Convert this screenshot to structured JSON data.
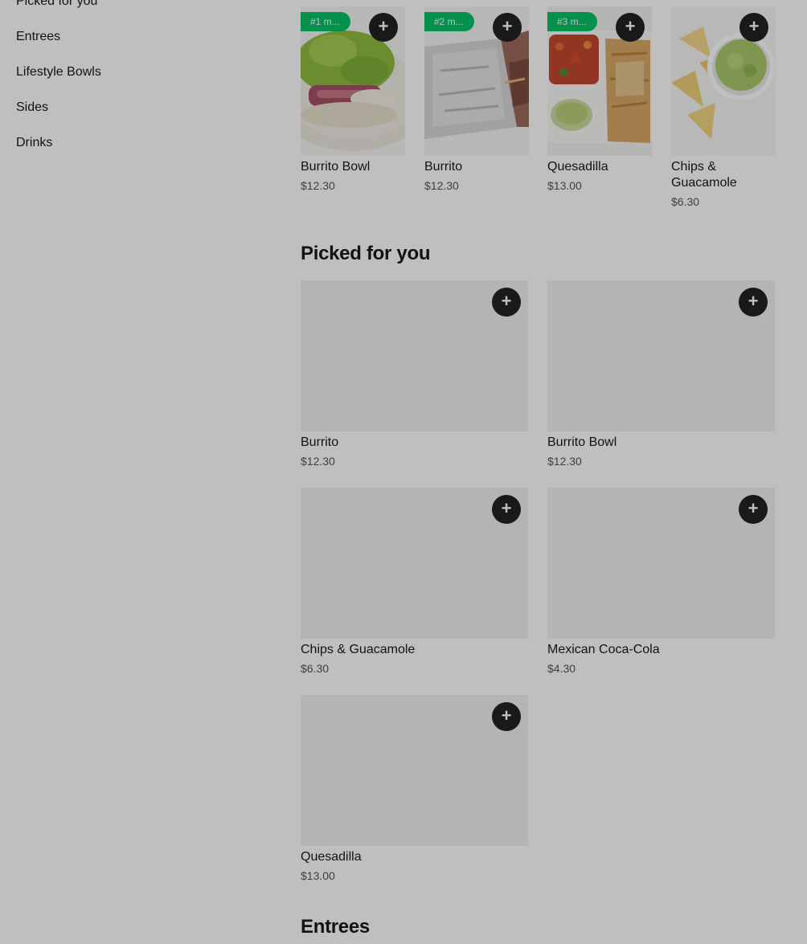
{
  "sidebar": {
    "items": [
      {
        "label": "Picked for you"
      },
      {
        "label": "Entrees"
      },
      {
        "label": "Lifestyle Bowls"
      },
      {
        "label": "Sides"
      },
      {
        "label": "Drinks"
      }
    ]
  },
  "popular": {
    "items": [
      {
        "rank_badge": "#1 m...",
        "name": "Burrito Bowl",
        "price": "$12.30",
        "add_icon": "plus-icon"
      },
      {
        "rank_badge": "#2 m...",
        "name": "Burrito",
        "price": "$12.30",
        "add_icon": "plus-icon"
      },
      {
        "rank_badge": "#3 m...",
        "name": "Quesadilla",
        "price": "$13.00",
        "add_icon": "plus-icon"
      },
      {
        "rank_badge": "",
        "name": "Chips & Guacamole",
        "price": "$6.30",
        "add_icon": "plus-icon"
      }
    ]
  },
  "picked_for_you": {
    "title": "Picked for you",
    "items": [
      {
        "name": "Burrito",
        "price": "$12.30"
      },
      {
        "name": "Burrito Bowl",
        "price": "$12.30"
      },
      {
        "name": "Chips & Guacamole",
        "price": "$6.30"
      },
      {
        "name": "Mexican Coca-Cola",
        "price": "$4.30"
      },
      {
        "name": "Quesadilla",
        "price": "$13.00"
      }
    ]
  },
  "entrees": {
    "title": "Entrees"
  },
  "icons": {
    "add": "+"
  },
  "colors": {
    "badge_green": "#06c167",
    "add_button": "#222222",
    "overlay": "rgba(0,0,0,0.25)"
  }
}
